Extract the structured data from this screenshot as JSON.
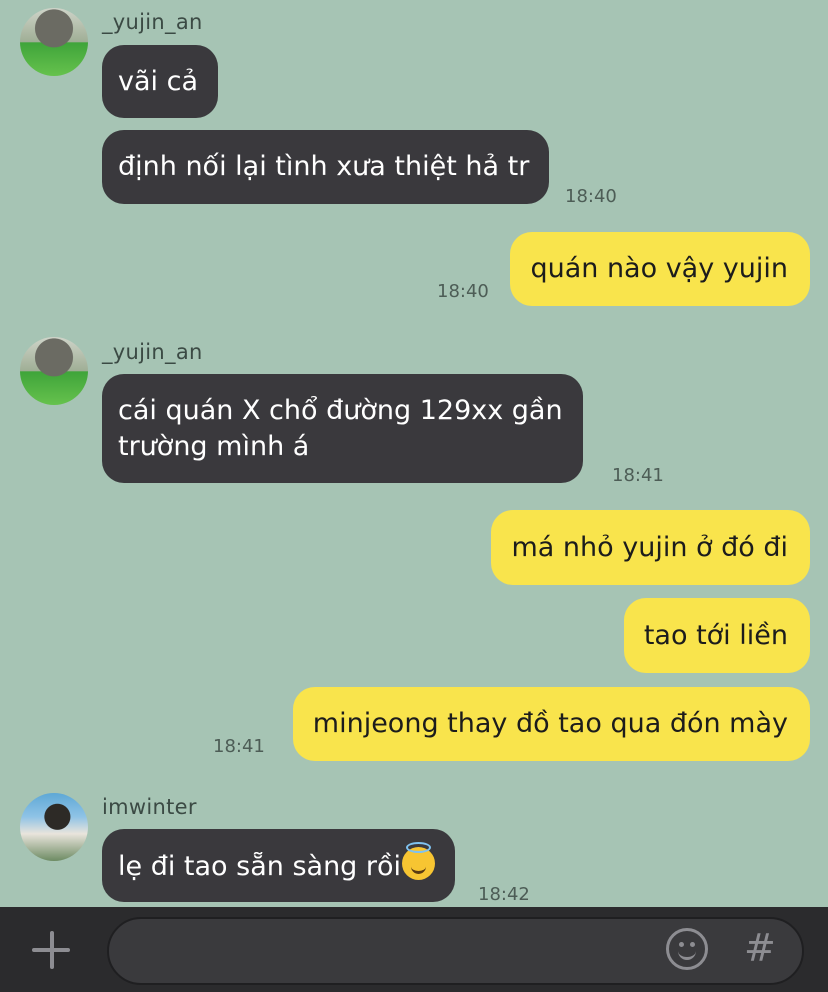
{
  "messages": [
    {
      "sender": "_yujin_an",
      "text": "vãi cả"
    },
    {
      "sender": "_yujin_an",
      "text": "định nối lại tình xưa thiệt hả tr",
      "time": "18:40"
    },
    {
      "sender": "me",
      "text": "quán nào vậy yujin",
      "time": "18:40"
    },
    {
      "sender": "_yujin_an",
      "text": "cái quán X chổ đường 129xx gần\ntrường mình á",
      "time": "18:41"
    },
    {
      "sender": "me",
      "text": "má nhỏ yujin ở đó đi"
    },
    {
      "sender": "me",
      "text": "tao tới liền"
    },
    {
      "sender": "me",
      "text": "minjeong thay đồ tao qua đón mày",
      "time": "18:41"
    },
    {
      "sender": "imwinter",
      "text": "lẹ đi tao sẵn sàng rồi",
      "emoji": "smiling-face-with-halo",
      "time": "18:42"
    }
  ],
  "senders": {
    "first": "_yujin_an",
    "second": "_yujin_an",
    "third": "imwinter"
  },
  "composer": {
    "plus_icon": "plus-icon",
    "emoji_icon": "smiley-icon",
    "hash_symbol": "#"
  },
  "colors": {
    "background": "#a6c4b4",
    "incoming_bubble": "#3a393d",
    "outgoing_bubble": "#f9e44c"
  }
}
